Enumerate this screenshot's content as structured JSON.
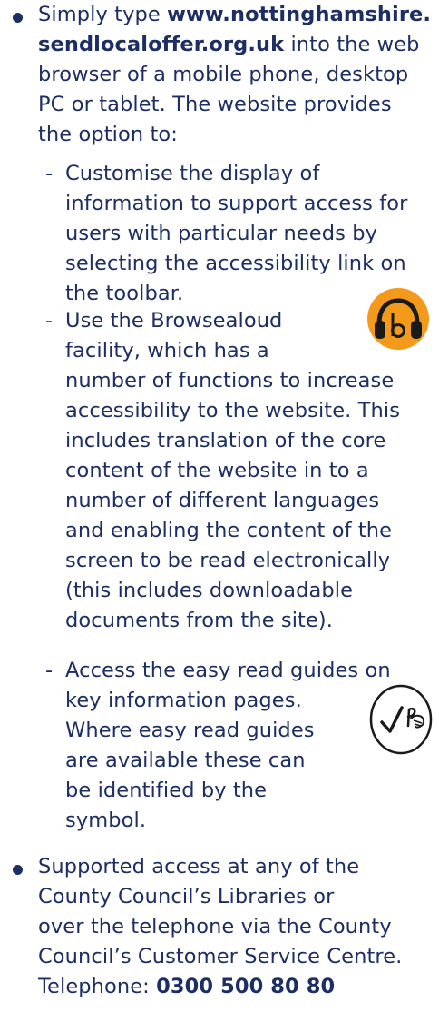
{
  "item1": {
    "lines": [
      [
        "Simply type ",
        "www.nottinghamshire."
      ],
      [
        "sendlocaloffer.org.uk",
        " into the web"
      ],
      [
        "browser of a mobile phone, desktop"
      ],
      [
        "PC or tablet. The website provides"
      ],
      [
        "the option to:"
      ]
    ]
  },
  "sub1": {
    "dash": "-",
    "lines": [
      "Customise the display of",
      "information to support access for",
      "users with particular needs by",
      "selecting the accessibility link on",
      "the toolbar."
    ]
  },
  "sub2": {
    "dash": "-",
    "lines": [
      "Use the Browsealoud",
      "facility, which has a",
      "number of functions to increase",
      "accessibility to the website. This",
      "includes translation of the core",
      "content of the website in to a",
      "number of different languages",
      "and enabling the content of the",
      "screen to be read electronically",
      "(this includes downloadable",
      "documents from the site)."
    ],
    "icon": "browsealoud-headphones-icon",
    "icon_color": "#f49a1b"
  },
  "sub3": {
    "dash": "-",
    "lines": [
      "Access the easy read guides on",
      "key information pages.",
      "Where easy read guides",
      "are available these can",
      "be identified by the",
      "symbol."
    ],
    "icon": "easy-read-symbol-icon"
  },
  "item2": {
    "lines": [
      "Supported access at any of the",
      "County Council’s Libraries or",
      "over the telephone via the County",
      "Council’s Customer Service Centre."
    ],
    "phone_label": "Telephone: ",
    "phone_number": "0300 500 80 80"
  },
  "colors": {
    "text": "#1c2e63",
    "accent": "#f49a1b"
  }
}
